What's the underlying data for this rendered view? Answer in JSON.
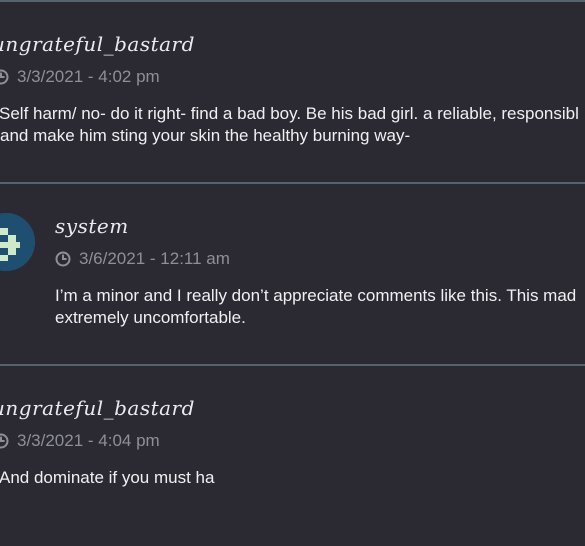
{
  "comments": [
    {
      "username": "ungrateful_bastard",
      "timestamp": "3/3/2021 - 4:02 pm",
      "text_lines": [
        "Self harm/ no- do it right- find a bad boy. Be his bad girl. a reliable, responsibl",
        "and make him sting your skin the healthy burning way-"
      ]
    },
    {
      "username": "system",
      "timestamp": "3/6/2021 - 12:11 am",
      "text_lines": [
        "I’m a minor and I really don’t appreciate comments like this. This mad",
        "extremely uncomfortable."
      ]
    },
    {
      "username": "ungrateful_bastard",
      "timestamp": "3/3/2021 - 4:04 pm",
      "text_lines": [
        "And dominate if you must ha"
      ]
    }
  ],
  "icons": {
    "timestamp": "clock-icon",
    "avatar": "pixel-avatar"
  },
  "colors": {
    "background": "#2b2a33",
    "divider": "#556270",
    "meta_text": "#8f8f99",
    "body_text": "#f0f0f3",
    "avatar_bg": "#1f4f70",
    "avatar_pixel": "#cfe8c8"
  }
}
